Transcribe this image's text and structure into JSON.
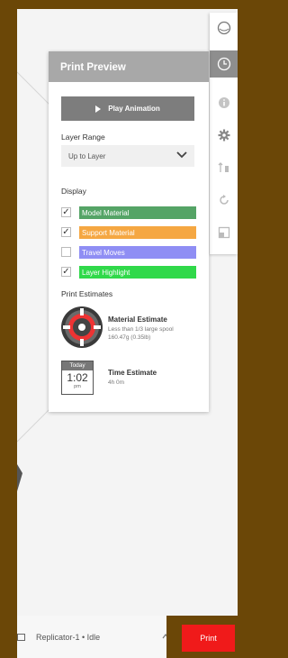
{
  "toolbar": {
    "icons": [
      "sphere-icon",
      "print-preview-clock-icon",
      "info-icon",
      "gear-icon",
      "scale-icon",
      "rotate-icon",
      "layout-icon"
    ]
  },
  "panel": {
    "title": "Print Preview",
    "play_label": "Play Animation",
    "layer_range_label": "Layer Range",
    "layer_range_value": "Up to Layer",
    "display_label": "Display",
    "display_items": [
      {
        "label": "Model Material",
        "checked": true,
        "color": "#55a466"
      },
      {
        "label": "Support Material",
        "checked": true,
        "color": "#f5a742"
      },
      {
        "label": "Travel Moves",
        "checked": false,
        "color": "#8f8ef4"
      },
      {
        "label": "Layer Highlight",
        "checked": true,
        "color": "#30d94a"
      }
    ],
    "estimates_label": "Print Estimates",
    "material": {
      "title": "Material Estimate",
      "line1": "Less than 1/3 large spool",
      "line2": "160.47g (0.35lb)"
    },
    "time": {
      "title": "Time Estimate",
      "value": "4h 0m",
      "cal_header": "Today",
      "cal_time": "1:02",
      "cal_ampm": "pm"
    }
  },
  "statusbar": {
    "printer": "Replicator-1 • Idle",
    "print_label": "Print"
  },
  "colors": {
    "accent": "#f01a1a",
    "frame": "#6b4707"
  }
}
